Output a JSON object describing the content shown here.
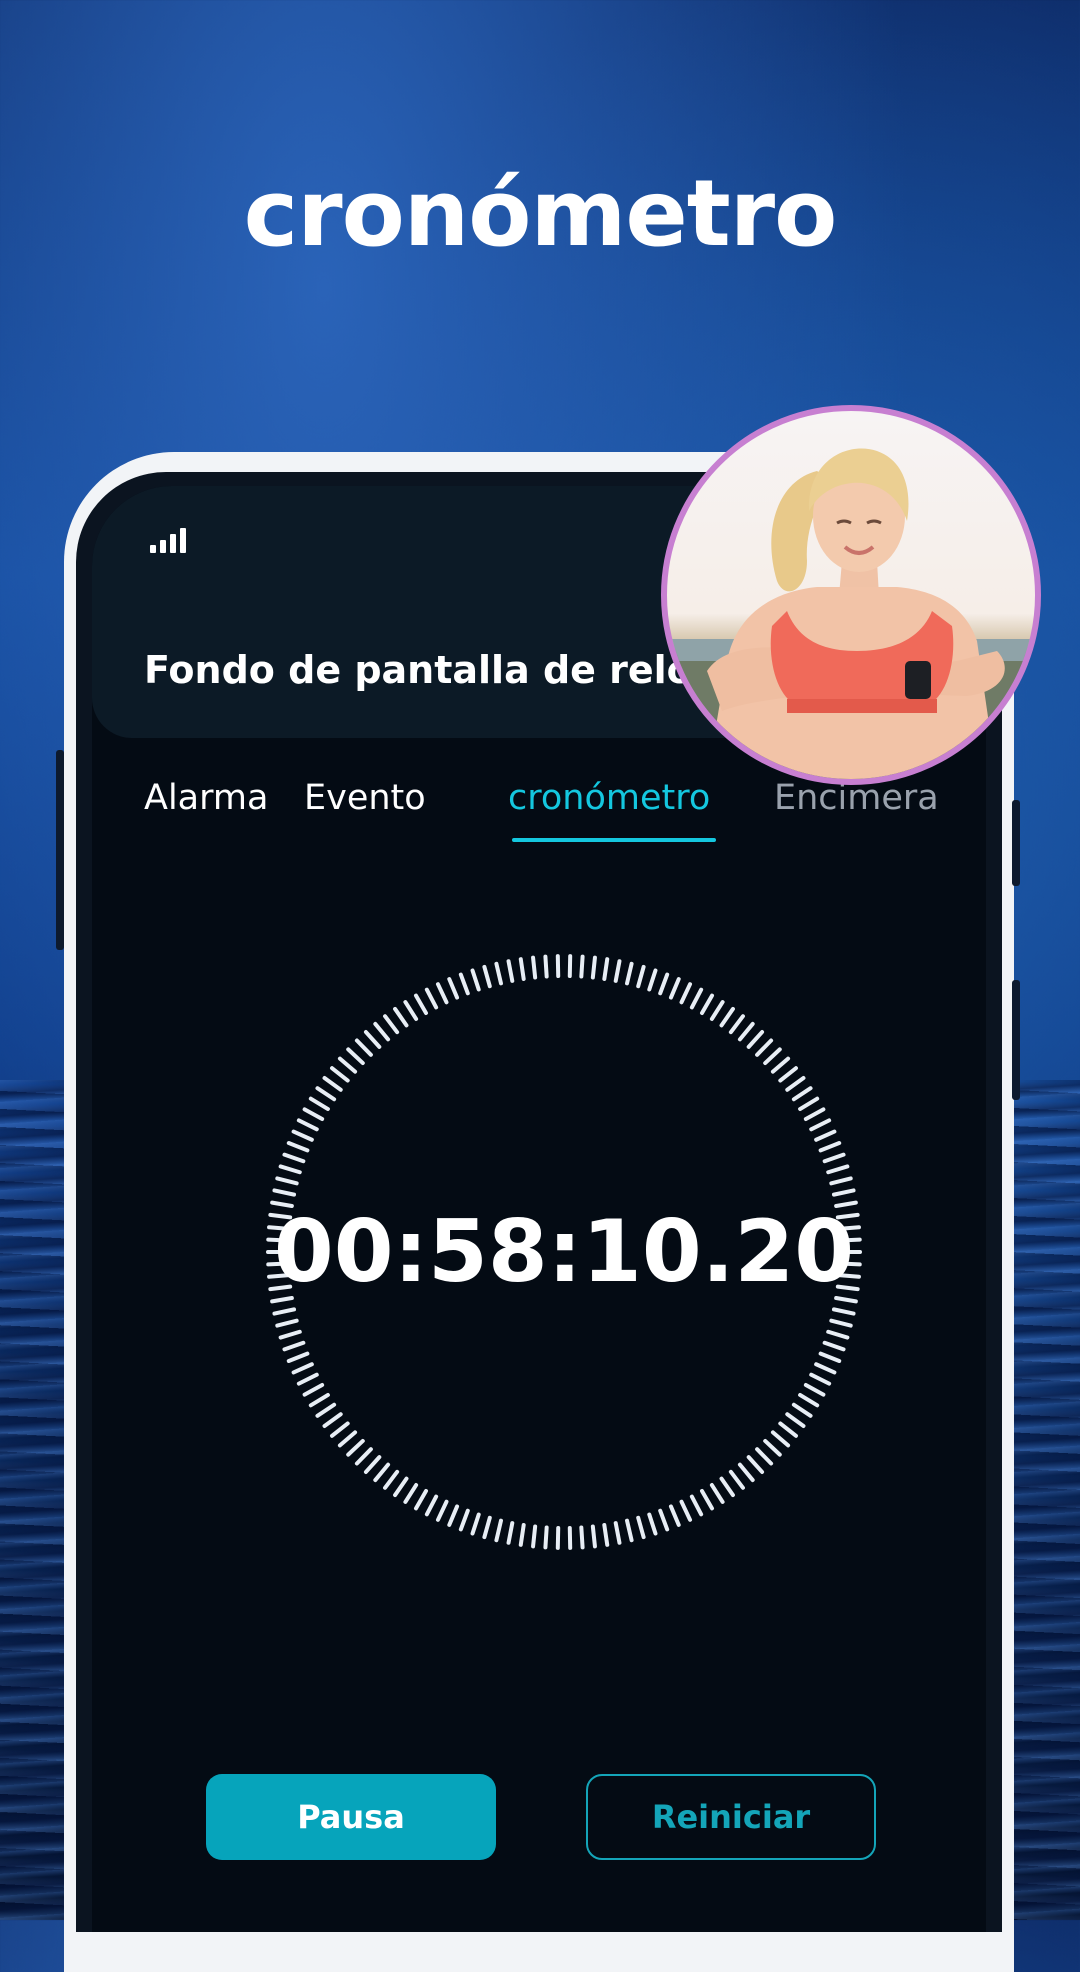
{
  "headline": "cronómetro",
  "app": {
    "title": "Fondo de pantalla de reloj d",
    "signal_icon": "signal-bars-icon"
  },
  "tabs": [
    {
      "label": "Alarma",
      "active": false
    },
    {
      "label": "Evento",
      "active": false
    },
    {
      "label": "cronómetro",
      "active": true
    },
    {
      "label": "Encimera",
      "active": false
    }
  ],
  "stopwatch": {
    "time": "00:58:10.20"
  },
  "buttons": {
    "pause_label": "Pausa",
    "reset_label": "Reiniciar"
  },
  "colors": {
    "accent": "#14c7df",
    "button_fill": "#06a4bb",
    "avatar_border": "#c77fd1",
    "screen_bg": "#040b14"
  },
  "avatar": {
    "icon": "woman-checking-smartwatch-photo"
  }
}
